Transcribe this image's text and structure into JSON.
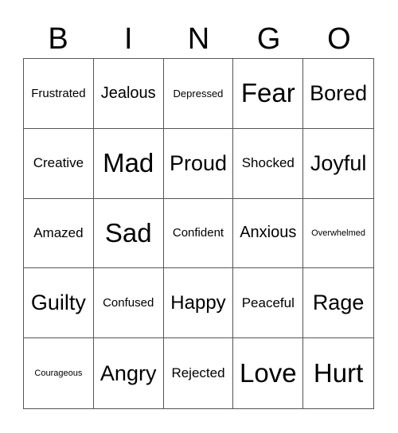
{
  "header": [
    "B",
    "I",
    "N",
    "G",
    "O"
  ],
  "cells": [
    [
      "Frustrated",
      "Jealous",
      "Depressed",
      "Fear",
      "Bored"
    ],
    [
      "Creative",
      "Mad",
      "Proud",
      "Shocked",
      "Joyful"
    ],
    [
      "Amazed",
      "Sad",
      "Confident",
      "Anxious",
      "Overwhelmed"
    ],
    [
      "Guilty",
      "Confused",
      "Happy",
      "Peaceful",
      "Rage"
    ],
    [
      "Courageous",
      "Angry",
      "Rejected",
      "Love",
      "Hurt"
    ]
  ]
}
